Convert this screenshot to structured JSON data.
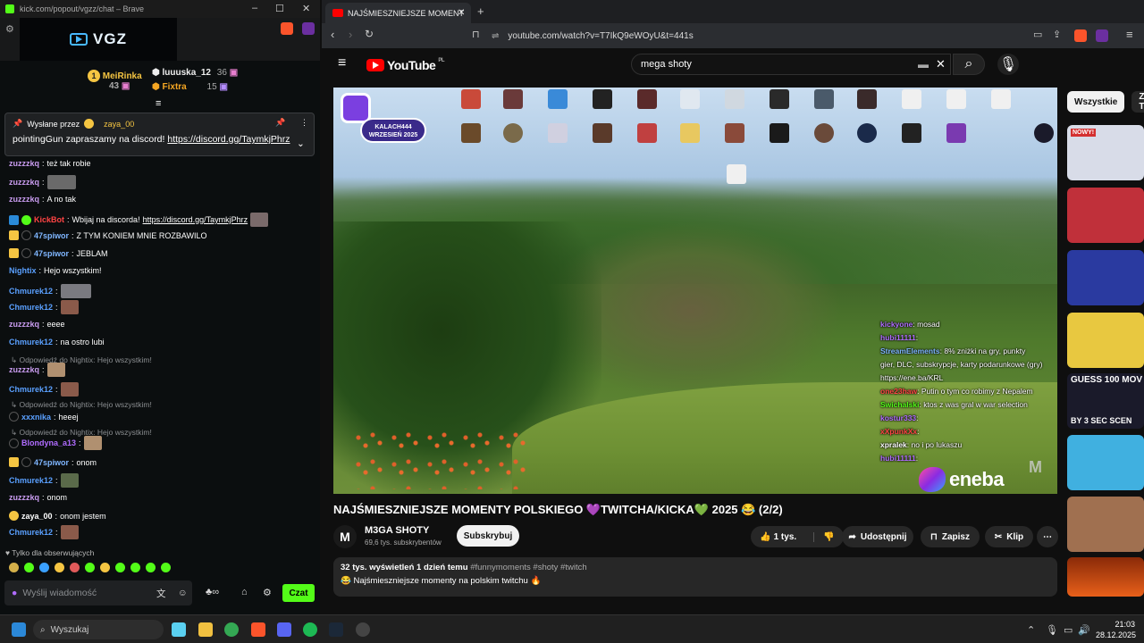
{
  "kick_window": {
    "title": "kick.com/popout/vgzz/chat – Brave",
    "logo_text": "VGZ",
    "leaderboard": [
      {
        "name": "MeiRinka",
        "count": "43",
        "color": "#f5c542",
        "rank": "1"
      },
      {
        "name": "luuuska_12",
        "count": "36",
        "color": "#e8e8e8",
        "rank": ""
      },
      {
        "name": "Fixtra",
        "count": "15",
        "color": "#f5a623",
        "rank": ""
      }
    ],
    "pinned": {
      "sent_by_label": "Wysłane przez",
      "sent_by_user": "zaya_00",
      "message_user": "pointingGun",
      "message_text": "zapraszamy na discord!",
      "link": "https://discord.gg/TaymkjPhrz"
    },
    "messages": [
      {
        "user": "zuzzzkq",
        "text": "też tak robie",
        "color": "#c99cf0"
      },
      {
        "user": "zuzzzkq",
        "text": "",
        "color": "#c99cf0"
      },
      {
        "user": "zuzzzkq",
        "text": "A no tak",
        "color": "#c99cf0"
      },
      {
        "user": "KickBot",
        "text": "Wbijaj na discorda!",
        "link": "https://discord.gg/TaymkjPhrz",
        "color": "#ff4444"
      },
      {
        "user": "47spiwor",
        "text": "Z TYM KONIEM MNIE ROZBAWILO",
        "color": "#7fb6ff"
      },
      {
        "user": "47spiwor",
        "text": "JEBLAM",
        "color": "#7fb6ff"
      },
      {
        "user": "Nightix",
        "text": "Hejo wszystkim!",
        "color": "#5aa0ff"
      },
      {
        "user": "Chmurek12",
        "text": "",
        "color": "#5aa0ff"
      },
      {
        "user": "Chmurek12",
        "text": "",
        "color": "#5aa0ff"
      },
      {
        "user": "zuzzzkq",
        "text": "eeee",
        "color": "#c99cf0"
      },
      {
        "user": "Chmurek12",
        "text": "na ostro lubi",
        "color": "#5aa0ff"
      },
      {
        "reply": "Odpowiedź do Nightix: Hejo wszystkim!"
      },
      {
        "user": "zuzzzkq",
        "text": "",
        "color": "#c99cf0"
      },
      {
        "user": "Chmurek12",
        "text": "",
        "color": "#5aa0ff"
      },
      {
        "reply": "Odpowiedź do Nightix: Hejo wszystkim!"
      },
      {
        "user": "xxxnika",
        "text": "heeej",
        "color": "#5aa0ff"
      },
      {
        "reply": "Odpowiedź do Nightix: Hejo wszystkim!"
      },
      {
        "user": "Blondyna_a13",
        "text": "",
        "color": "#b06cff"
      },
      {
        "user": "47spiwor",
        "text": "onom",
        "color": "#7fb6ff"
      },
      {
        "user": "Chmurek12",
        "text": "",
        "color": "#5aa0ff"
      },
      {
        "user": "zuzzzkq",
        "text": "onom",
        "color": "#c99cf0"
      },
      {
        "user": "zaya_00",
        "text": "onom jestem",
        "color": "#fff"
      },
      {
        "user": "Chmurek12",
        "text": "",
        "color": "#5aa0ff"
      }
    ],
    "followers_only": "Tylko dla obserwujących",
    "input_placeholder": "Wyślij wiadomość",
    "send_label": "Czat"
  },
  "brave": {
    "tab_title": "NAJŚMIESZNIEJSZE MOMENT",
    "url": "youtube.com/watch?v=T7IkQ9eWOyU&t=441s",
    "search_query": "mega shoty",
    "yt_region": "PL",
    "yt_logo": "YouTube"
  },
  "video": {
    "kalach_line1": "KALACH444",
    "kalach_line2": "WRZESIEŃ 2025",
    "sponsor": "eneba",
    "watermark": "M",
    "overlay_chat": [
      {
        "user": "kickyone",
        "text": "mosad",
        "color": "#b06cff"
      },
      {
        "user": "hubi11111",
        "text": "",
        "color": "#b06cff"
      },
      {
        "user": "StreamElements",
        "text": "8% zniżki na gry, punkty",
        "color": "#7fb6ff"
      },
      {
        "user": "",
        "text": "gier, DLC, subskrypcje, karty podarunkowe (gry)",
        "color": "#fff"
      },
      {
        "user": "",
        "text": "https://ene.ba/KRL",
        "color": "#fff"
      },
      {
        "user": "one23haw",
        "text": "Putin o tym co robimy z Nepalem",
        "color": "#ff4444"
      },
      {
        "user": "Swichalski",
        "text": "ktos z was gral w war selection",
        "color": "#53fc18"
      },
      {
        "user": "kostur333",
        "text": "",
        "color": "#b06cff"
      },
      {
        "user": "xXpunkXx",
        "text": "",
        "color": "#ff4444"
      },
      {
        "user": "xpralek",
        "text": "no i po lukaszu",
        "color": "#fff"
      },
      {
        "user": "hubi11111",
        "text": "",
        "color": "#b06cff"
      }
    ]
  },
  "watch": {
    "title": "NAJŚMIESZNIEJSZE MOMENTY POLSKIEGO 💜TWITCHA/KICKA💚 2025 😂 (2/2)",
    "channel_name": "M3GA SHOTY",
    "subscribers": "69,6 tys. subskrybentów",
    "subscribe_label": "Subskrybuj",
    "likes": "1 tys.",
    "share_label": "Udostępnij",
    "save_label": "Zapisz",
    "clip_label": "Klip",
    "views": "32 tys. wyświetleń",
    "age": "1 dzień temu",
    "hashtags": "#funnymoments #shoty #twitch",
    "description": "😂 Najśmieszniejsze momenty na polskim twitchu 🔥"
  },
  "chips": [
    "Wszystkie",
    "Z TW"
  ],
  "thumbnails": [
    {
      "label": "NOWY!",
      "color": "#d43030"
    },
    {
      "label": "",
      "color": "#c0303a"
    },
    {
      "label": "",
      "color": "#2a3aa0"
    },
    {
      "label": "",
      "color": "#e8c840"
    },
    {
      "label": "GUESS 100 MOV",
      "label2": "BY 3 SEC SCEN",
      "color": "#111"
    },
    {
      "label": "",
      "color": "#40b0e0"
    },
    {
      "label": "",
      "color": "#a07050"
    },
    {
      "label": "",
      "color": "#c04010"
    }
  ],
  "taskbar": {
    "search_placeholder": "Wyszukaj",
    "time": "21:03",
    "date": "28.12.2025"
  }
}
